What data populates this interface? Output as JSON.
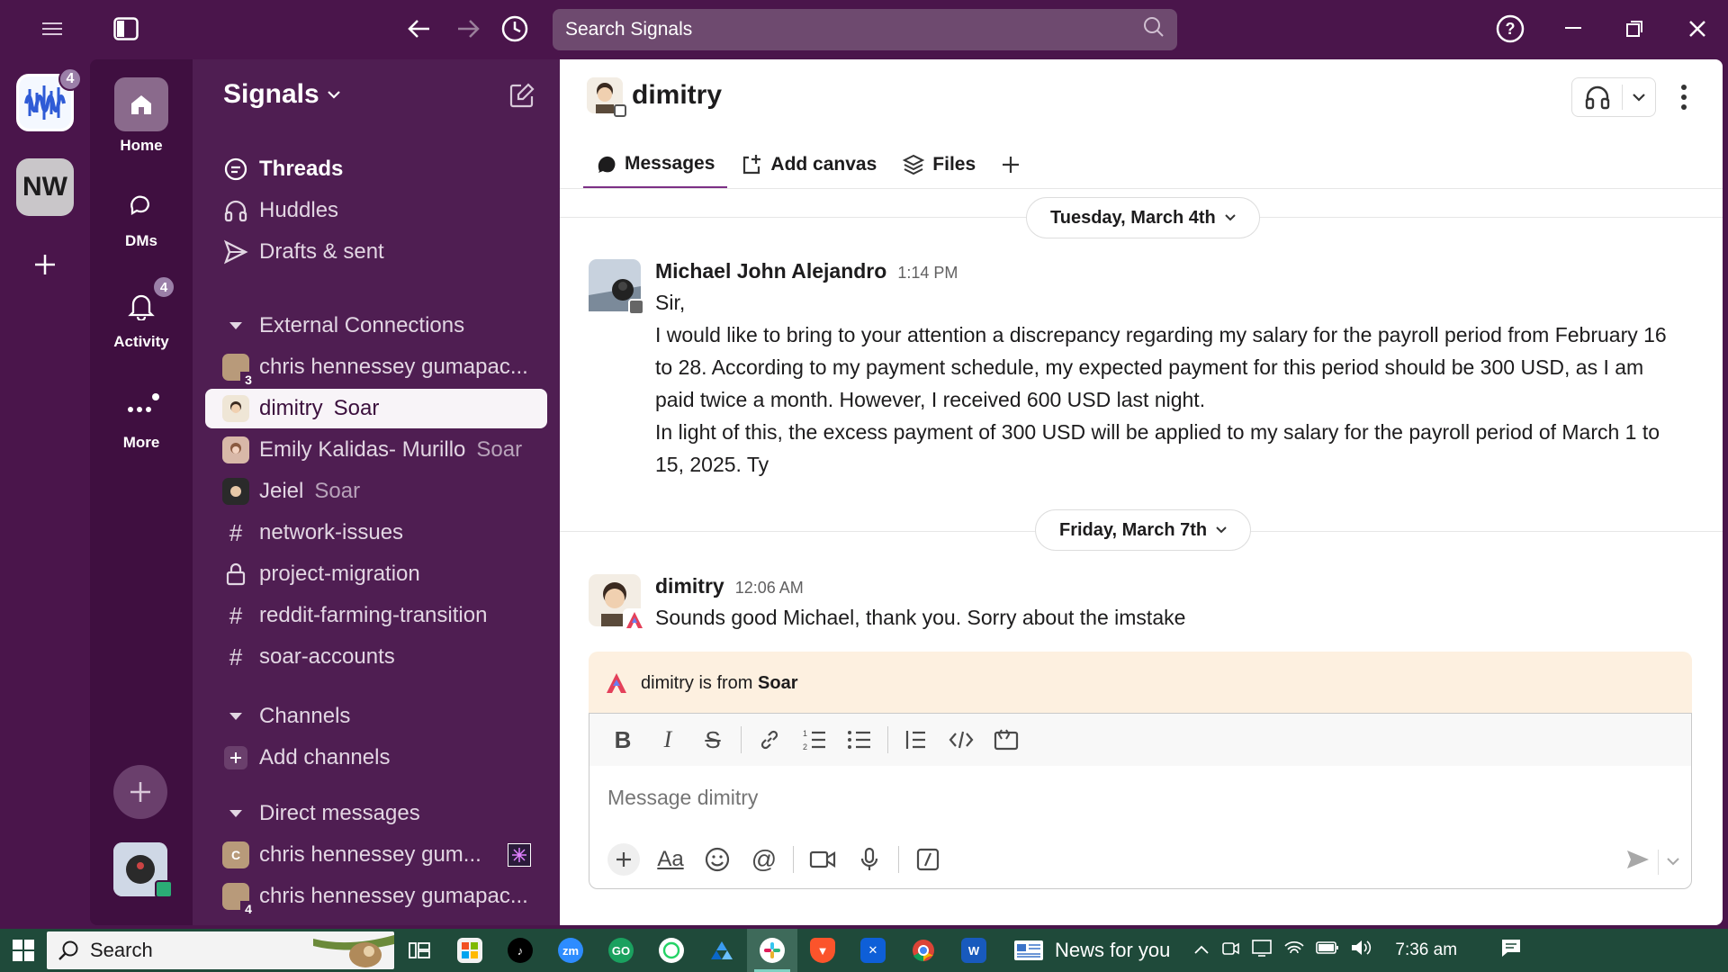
{
  "colors": {
    "aubergine": "#4a154b",
    "nav_bg": "#3f0f40",
    "sidebar_bg": "#4f1e52",
    "accent": "#7c3085",
    "badge": "#9b7fa8",
    "taskbar": "#1f4a3a",
    "banner": "#fdf0e0"
  },
  "titlebar": {
    "search_placeholder": "Search Signals",
    "icons": [
      "menu-icon",
      "sidebar-toggle-icon",
      "back-arrow-icon",
      "forward-arrow-icon",
      "history-icon",
      "help-icon",
      "minimize-icon",
      "restore-icon",
      "close-icon"
    ]
  },
  "rail": {
    "workspaces": [
      {
        "name": "Signals",
        "badge": "4"
      },
      {
        "name": "NW",
        "initials": "NW"
      }
    ],
    "add_label": "+"
  },
  "nav": {
    "home": "Home",
    "dms": "DMs",
    "activity": "Activity",
    "activity_badge": "4",
    "more": "More"
  },
  "sidebar": {
    "workspace_name": "Signals",
    "top": [
      {
        "label": "Threads",
        "icon": "threads-icon"
      },
      {
        "label": "Huddles",
        "icon": "headphones-icon"
      },
      {
        "label": "Drafts & sent",
        "icon": "send-icon"
      }
    ],
    "external_header": "External Connections",
    "external": [
      {
        "label": "chris hennessey gumapac...",
        "count": "3"
      },
      {
        "label": "dimitry",
        "org": "Soar",
        "active": true
      },
      {
        "label": "Emily Kalidas- Murillo",
        "org": "Soar"
      },
      {
        "label": "Jeiel",
        "org": "Soar"
      },
      {
        "label": "network-issues",
        "icon": "hash-icon"
      },
      {
        "label": "project-migration",
        "icon": "lock-icon"
      },
      {
        "label": "reddit-farming-transition",
        "icon": "hash-icon"
      },
      {
        "label": "soar-accounts",
        "icon": "hash-icon"
      }
    ],
    "channels_header": "Channels",
    "add_channels": "Add channels",
    "dm_header": "Direct messages",
    "dms": [
      {
        "label": "chris hennessey gum...",
        "initial": "C"
      },
      {
        "label": "chris hennessey gumapac...",
        "count": "4"
      }
    ]
  },
  "channel": {
    "name": "dimitry",
    "tabs": [
      {
        "label": "Messages",
        "icon": "message-icon"
      },
      {
        "label": "Add canvas",
        "icon": "canvas-icon"
      },
      {
        "label": "Files",
        "icon": "files-icon"
      }
    ]
  },
  "dates": [
    "Tuesday, March 4th",
    "Friday, March 7th"
  ],
  "messages": [
    {
      "author": "Michael John Alejandro",
      "time": "1:14 PM",
      "lines": [
        "Sir,",
        "I would like to bring to your attention a discrepancy regarding my salary for the payroll period from February 16 to 28. According to my payment schedule, my expected payment for this period should be 300 USD, as I am paid twice a month. However, I received 600 USD last night.",
        "In light of this, the excess payment of 300 USD will be applied to my salary for the payroll period of March 1 to 15, 2025. Ty"
      ]
    },
    {
      "author": "dimitry",
      "time": "12:06 AM",
      "lines": [
        "Sounds good Michael, thank you. Sorry about the imstake"
      ]
    }
  ],
  "banner": {
    "prefix": "dimitry is from",
    "org": "Soar"
  },
  "composer": {
    "placeholder": "Message dimitry",
    "aa_label": "Aa"
  },
  "taskbar": {
    "search": "Search",
    "news": "News for you",
    "time": "7:36 am",
    "apps": [
      {
        "name": "task-view",
        "label": ""
      },
      {
        "name": "store",
        "label": ""
      },
      {
        "name": "tiktok",
        "label": ""
      },
      {
        "name": "zoom",
        "label": "zm"
      },
      {
        "name": "gocardless",
        "label": "GO"
      },
      {
        "name": "whatsapp",
        "label": ""
      },
      {
        "name": "onedrive",
        "label": ""
      },
      {
        "name": "slack",
        "label": ""
      },
      {
        "name": "brave",
        "label": ""
      },
      {
        "name": "teamviewer",
        "label": ""
      },
      {
        "name": "chrome",
        "label": ""
      },
      {
        "name": "word",
        "label": "W"
      }
    ]
  }
}
